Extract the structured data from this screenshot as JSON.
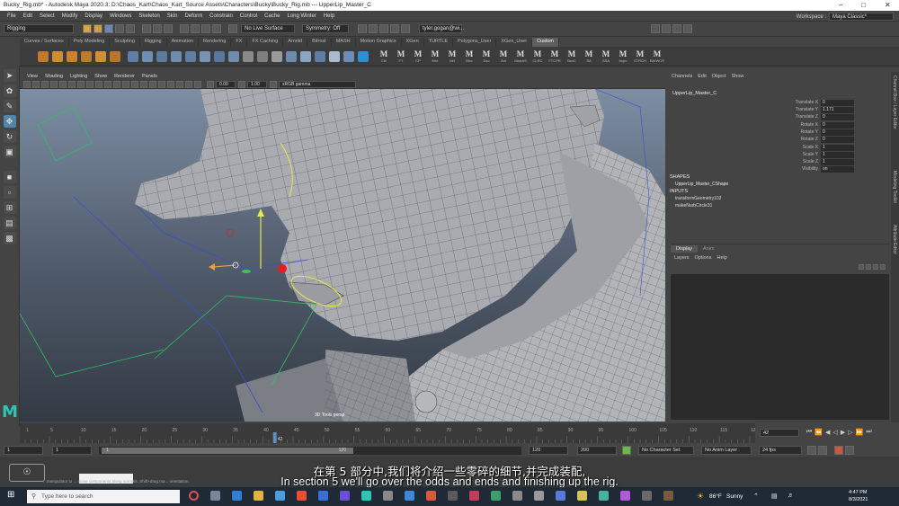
{
  "window": {
    "title": "Bucky_Rig.mb* - Autodesk Maya 2020.3: D:\\Chaos_Kart\\Chaos_Kart_Source Assets\\Characters\\Bucky\\Bucky_Rig.mb --- UpperLip_Master_C"
  },
  "menu": [
    "File",
    "Edit",
    "Select",
    "Modify",
    "Display",
    "Windows",
    "Skeleton",
    "Skin",
    "Deform",
    "Constrain",
    "Control",
    "Cache",
    "Long Winter",
    "Help"
  ],
  "workspace": {
    "label": "Workspace :",
    "value": "Maya Classic*"
  },
  "status": {
    "menuset": "Rigging",
    "live_surface": "No Live Surface",
    "symmetry": "Symmetry: Off",
    "user": "tyler.gogan@wi..."
  },
  "shelf": {
    "tabs": [
      "Curves / Surfaces",
      "Poly Modeling",
      "Sculpting",
      "Rigging",
      "Animation",
      "Rendering",
      "FX",
      "FX Caching",
      "Arnold",
      "Bifrost",
      "MASH",
      "Motion Graphics",
      "XGen",
      "TURTLE",
      "Polygons_User",
      "XGen_User",
      "Custom"
    ],
    "active_tab": "Custom",
    "m_buttons": [
      "Ctrl",
      "FT",
      "CP",
      "Mrrl",
      "Mrl",
      "Mxc",
      "Zoo",
      "Ani",
      "MatchS",
      "CLRC",
      "FTCPR",
      "BoxC",
      "SA",
      "SSA",
      "Impo",
      "STRCH",
      "BWWCR"
    ]
  },
  "viewport": {
    "menu": [
      "View",
      "Shading",
      "Lighting",
      "Show",
      "Renderer",
      "Panels"
    ],
    "exposure": "0.00",
    "gamma": "1.00",
    "colorspace": "sRGB gamma",
    "camera_label": "3D Tools      persp"
  },
  "channel_box": {
    "menu": [
      "Channels",
      "Edit",
      "Object",
      "Show"
    ],
    "object": "UpperLip_Master_C",
    "attributes": [
      {
        "name": "Translate X",
        "value": "0"
      },
      {
        "name": "Translate Y",
        "value": "1.171"
      },
      {
        "name": "Translate Z",
        "value": "0"
      },
      {
        "name": "Rotate X",
        "value": "0"
      },
      {
        "name": "Rotate Y",
        "value": "0"
      },
      {
        "name": "Rotate Z",
        "value": "0"
      },
      {
        "name": "Scale X",
        "value": "1"
      },
      {
        "name": "Scale Y",
        "value": "1"
      },
      {
        "name": "Scale Z",
        "value": "1"
      },
      {
        "name": "Visibility",
        "value": "on"
      }
    ],
    "shapes_label": "SHAPES",
    "shape": "UpperLip_Master_CShape",
    "inputs_label": "INPUTS",
    "inputs": [
      "transformGeometry102",
      "makeNurbCircle31"
    ]
  },
  "layer_editor": {
    "tabs": [
      "Display",
      "Anim"
    ],
    "menu": [
      "Layers",
      "Options",
      "Help"
    ]
  },
  "side_tabs": [
    "Channel Box / Layer Editor",
    "Modeling Toolkit",
    "Attribute Editor"
  ],
  "timeline": {
    "ticks": [
      "1",
      "5",
      "10",
      "15",
      "20",
      "25",
      "30",
      "35",
      "40",
      "45",
      "50",
      "55",
      "60",
      "65",
      "70",
      "75",
      "80",
      "85",
      "90",
      "95",
      "100",
      "105",
      "110",
      "115",
      "120"
    ],
    "current_frame": "42",
    "frame_field": "42"
  },
  "range": {
    "start": "1",
    "start2": "1",
    "inner_start": "1",
    "inner_end": "120",
    "end": "120",
    "end2": "200",
    "character_set": "No Character Set",
    "anim_layer": "No Anim Layer",
    "fps": "24 fps"
  },
  "help_line": "...manipulator to ... move components along normals. Shift+drag ma...                                                                                                orientation.",
  "taskbar": {
    "search_placeholder": "Type here to search",
    "weather_temp": "86°F",
    "weather_desc": "Sunny",
    "time": "4:47 PM",
    "date": "8/3/2021"
  },
  "subtitles": {
    "zh": "在第 5 部分中,我们将介绍一些零碎的细节,并完成装配,",
    "en": "In section 5 we'll go over the odds and ends and finishing up the rig."
  }
}
